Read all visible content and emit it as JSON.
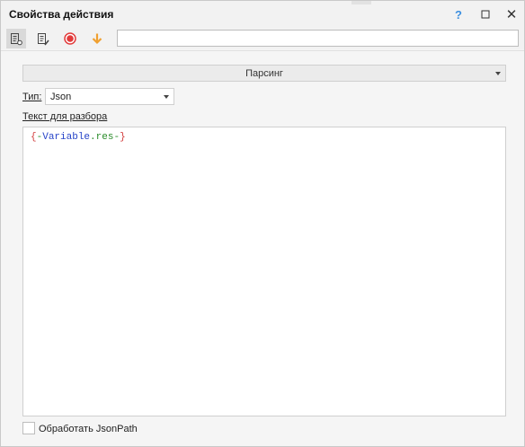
{
  "window": {
    "title": "Свойства действия",
    "help": "?",
    "close": "✕"
  },
  "toolbar": {
    "icons": [
      "properties-icon",
      "edit-properties-icon",
      "record-icon",
      "download-arrow-icon"
    ],
    "input_value": ""
  },
  "action": {
    "selected": "Парсинг"
  },
  "type": {
    "label": "Тип:",
    "value": "Json"
  },
  "text": {
    "label": "Текст для разбора",
    "code_open": "{",
    "code_dash1": "-",
    "code_var": "Variable",
    "code_dot": ".",
    "code_res": "res",
    "code_dash2": "-",
    "code_close": "}"
  },
  "option": {
    "label": "Обработать JsonPath",
    "checked": false
  },
  "colors": {
    "accent_help": "#3c8fe0",
    "record_red": "#e23b3b",
    "arrow_orange": "#f0a030",
    "code_var_blue": "#2845c8",
    "code_brace_red": "#d23c3c",
    "code_green": "#2a8c2a"
  }
}
